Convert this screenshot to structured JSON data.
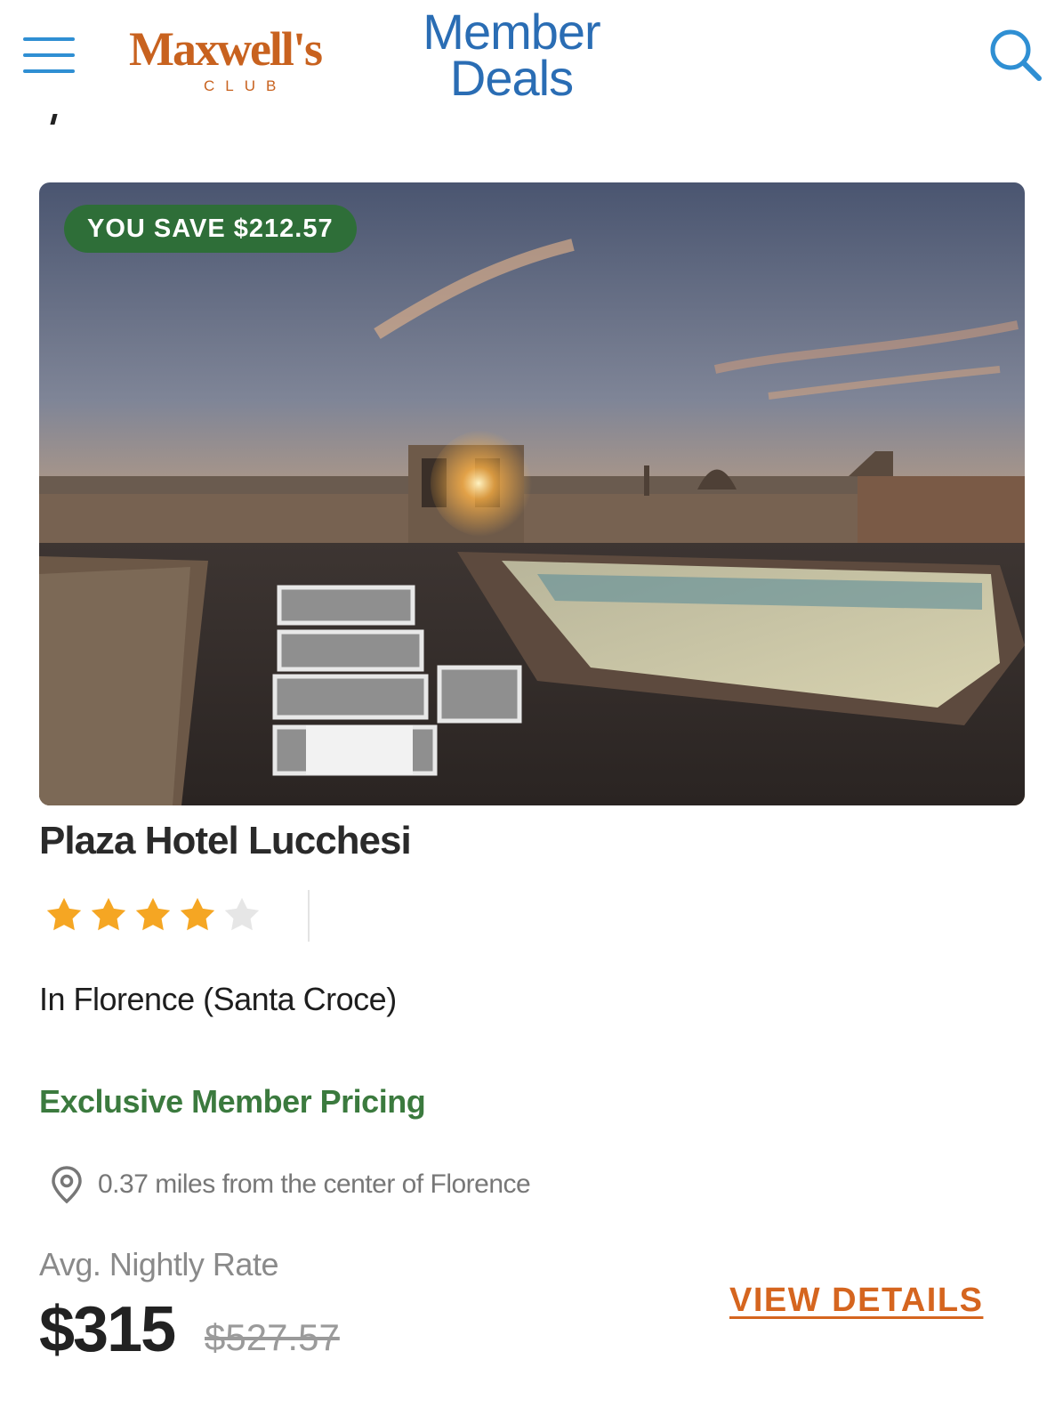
{
  "header": {
    "logo": {
      "name": "Maxwell's",
      "sub": "CLUB"
    },
    "section_title": {
      "line1": "Member",
      "line2": "Deals"
    },
    "accent_color": "#2f8fd3",
    "logo_color": "#c8621f"
  },
  "hotel": {
    "badge": "YOU SAVE $212.57",
    "name": "Plaza Hotel Lucchesi",
    "rating": {
      "stars": 4,
      "max": 5
    },
    "location": "In Florence (Santa Croce)",
    "pricing_note": "Exclusive Member Pricing",
    "distance": "0.37 miles from the center of Florence",
    "rate_label": "Avg. Nightly Rate",
    "price": "$315",
    "original_price": "$527.57",
    "cta": "VIEW DETAILS"
  },
  "colors": {
    "badge_bg": "#2e6e38",
    "pricing_green": "#3b7a3e",
    "cta_orange": "#d5651f",
    "star_filled": "#f5a623",
    "star_empty": "#e6e6e6"
  },
  "icons": [
    "hamburger-menu-icon",
    "search-icon",
    "star-icon",
    "location-pin-icon"
  ]
}
